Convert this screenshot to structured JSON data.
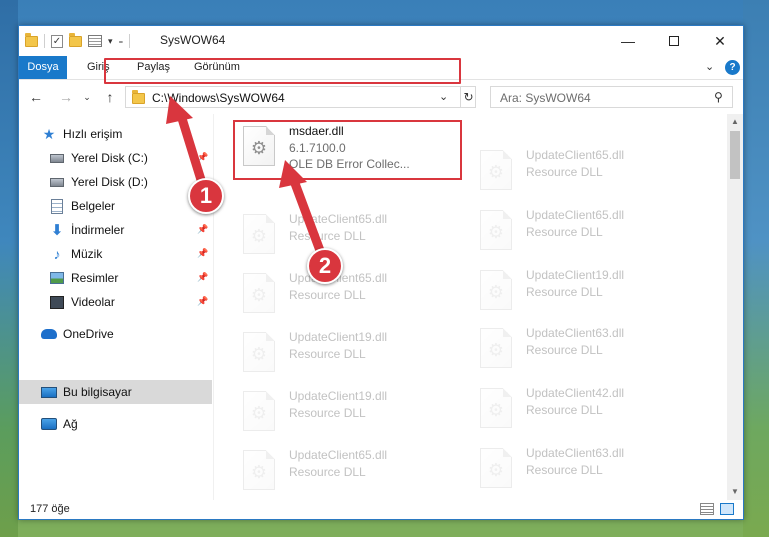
{
  "window": {
    "title": "SysWOW64",
    "minimize_icon": "minimize-icon",
    "close_icon": "close-icon"
  },
  "ribbon": {
    "tabs": [
      {
        "label": "Dosya",
        "active": true
      },
      {
        "label": "Giriş"
      },
      {
        "label": "Paylaş"
      },
      {
        "label": "Görünüm"
      }
    ],
    "help": "?"
  },
  "nav": {
    "address": "C:\\Windows\\SysWOW64",
    "search_placeholder": "Ara: SysWOW64"
  },
  "sidebar": {
    "items": [
      {
        "label": "Hızlı erişim",
        "icon": "star-icon"
      },
      {
        "label": "Yerel Disk (C:)",
        "icon": "disk-icon",
        "pinned": true
      },
      {
        "label": "Yerel Disk (D:)",
        "icon": "disk-icon"
      },
      {
        "label": "Belgeler",
        "icon": "document-icon"
      },
      {
        "label": "İndirmeler",
        "icon": "download-icon",
        "pinned": true
      },
      {
        "label": "Müzik",
        "icon": "music-icon",
        "pinned": true
      },
      {
        "label": "Resimler",
        "icon": "pictures-icon",
        "pinned": true
      },
      {
        "label": "Videolar",
        "icon": "videos-icon",
        "pinned": true
      },
      {
        "label": "OneDrive",
        "icon": "onedrive-icon"
      },
      {
        "label": "Bu bilgisayar",
        "icon": "computer-icon",
        "selected": true
      },
      {
        "label": "Ağ",
        "icon": "network-icon"
      }
    ]
  },
  "files": {
    "highlighted": {
      "name": "msdaer.dll",
      "version": "6.1.7100.0",
      "description": "OLE DB Error Collec..."
    },
    "left_column": [
      {
        "name": "UpdateClient65.dll",
        "type": "Resource DLL"
      },
      {
        "name": "UpdateClient65.dll",
        "type": "Resource DLL"
      },
      {
        "name": "UpdateClient19.dll",
        "type": "Resource DLL"
      },
      {
        "name": "UpdateClient19.dll",
        "type": "Resource DLL"
      },
      {
        "name": "UpdateClient65.dll",
        "type": "Resource DLL"
      }
    ],
    "right_column": [
      {
        "name": "UpdateClient65.dll",
        "type": "Resource DLL"
      },
      {
        "name": "UpdateClient65.dll",
        "type": "Resource DLL"
      },
      {
        "name": "UpdateClient19.dll",
        "type": "Resource DLL"
      },
      {
        "name": "UpdateClient63.dll",
        "type": "Resource DLL"
      },
      {
        "name": "UpdateClient42.dll",
        "type": "Resource DLL"
      },
      {
        "name": "UpdateClient63.dll",
        "type": "Resource DLL"
      }
    ]
  },
  "status": {
    "item_count": "177 öğe"
  },
  "annotations": {
    "step1": "1",
    "step2": "2",
    "color": "#d9363e"
  }
}
